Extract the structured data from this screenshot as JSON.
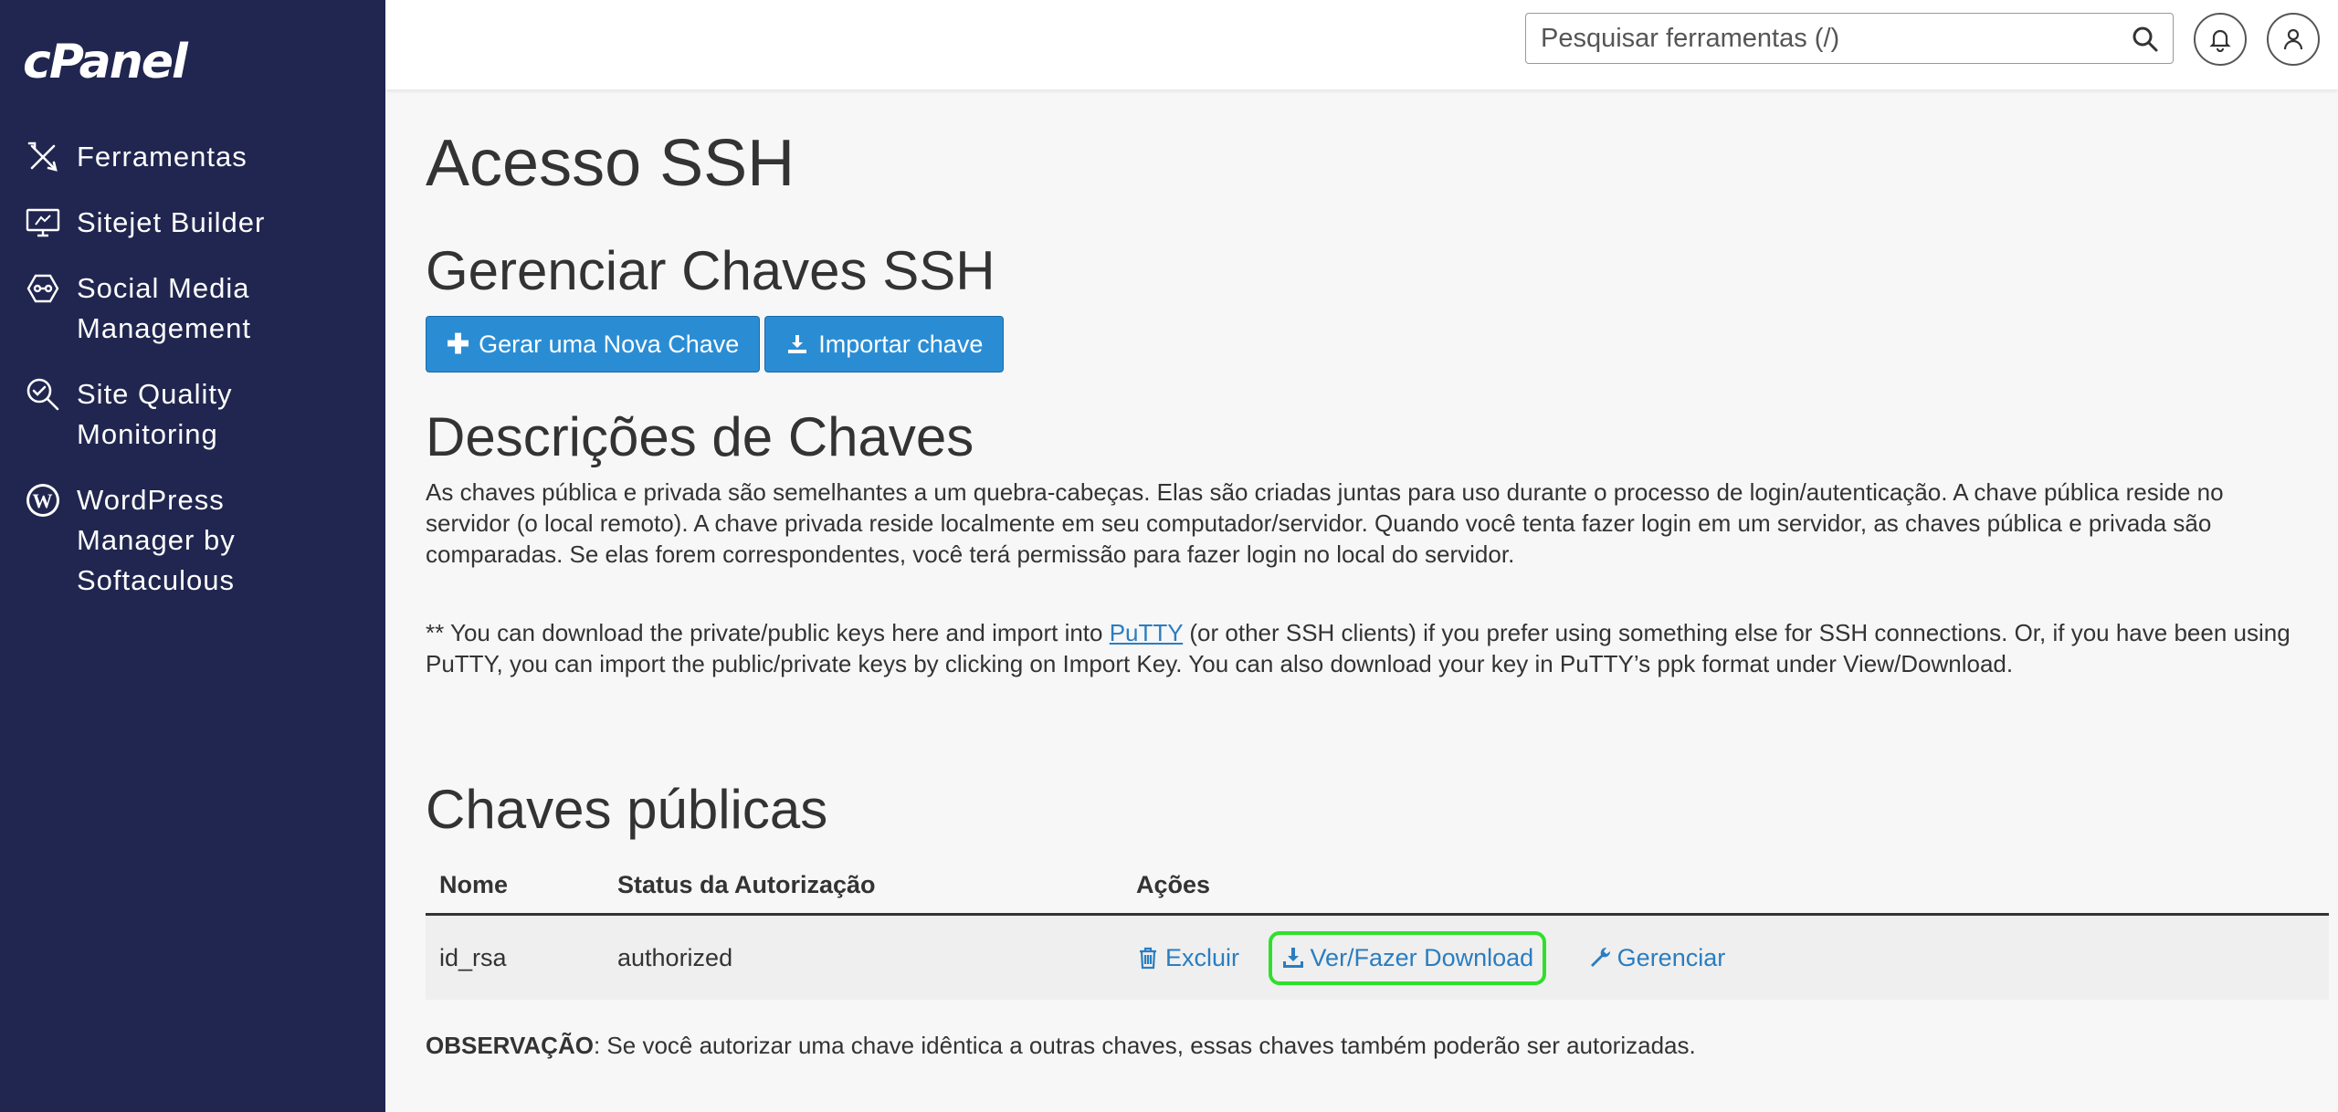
{
  "brand": {
    "logo": "cPanel"
  },
  "sidebar": {
    "items": [
      {
        "label": "Ferramentas",
        "icon": "tools-icon"
      },
      {
        "label": "Sitejet Builder",
        "icon": "monitor-icon"
      },
      {
        "label": "Social Media Management",
        "icon": "social-icon"
      },
      {
        "label": "Site Quality Monitoring",
        "icon": "magnifier-check-icon"
      },
      {
        "label": "WordPress Manager by Softaculous",
        "icon": "wordpress-icon"
      }
    ]
  },
  "topbar": {
    "search_placeholder": "Pesquisar ferramentas (/)"
  },
  "main": {
    "title": "Acesso SSH",
    "manage_heading": "Gerenciar Chaves SSH",
    "generate_button": "Gerar uma Nova Chave",
    "import_button": "Importar chave",
    "desc_heading": "Descrições de Chaves",
    "desc_paragraph": "As chaves pública e privada são semelhantes a um quebra-cabeças. Elas são criadas juntas para uso durante o processo de login/autenticação. A chave pública reside no servidor (o local remoto). A chave privada reside localmente em seu computador/servidor. Quando você tenta fazer login em um servidor, as chaves pública e privada são comparadas. Se elas forem correspondentes, você terá permissão para fazer login no local do servidor.",
    "putty_before": "** You can download the private/public keys here and import into ",
    "putty_link": "PuTTY",
    "putty_after": " (or other SSH clients) if you prefer using something else for SSH connections. Or, if you have been using PuTTY, you can import the public/private keys by clicking on Import Key. You can also download your key in PuTTY’s ppk format under View/Download.",
    "public_keys_heading": "Chaves públicas",
    "table": {
      "headers": [
        "Nome",
        "Status da Autorização",
        "Ações"
      ],
      "rows": [
        {
          "name": "id_rsa",
          "status": "authorized",
          "actions": [
            "Excluir",
            "Ver/Fazer Download",
            "Gerenciar"
          ]
        }
      ]
    },
    "note_label": "OBSERVAÇÃO",
    "note_text": ": Se você autorizar uma chave idêntica a outras chaves, essas chaves também poderão ser autorizadas.",
    "highlight_color": "#2fe02a",
    "accent_color": "#2a8dd4"
  }
}
